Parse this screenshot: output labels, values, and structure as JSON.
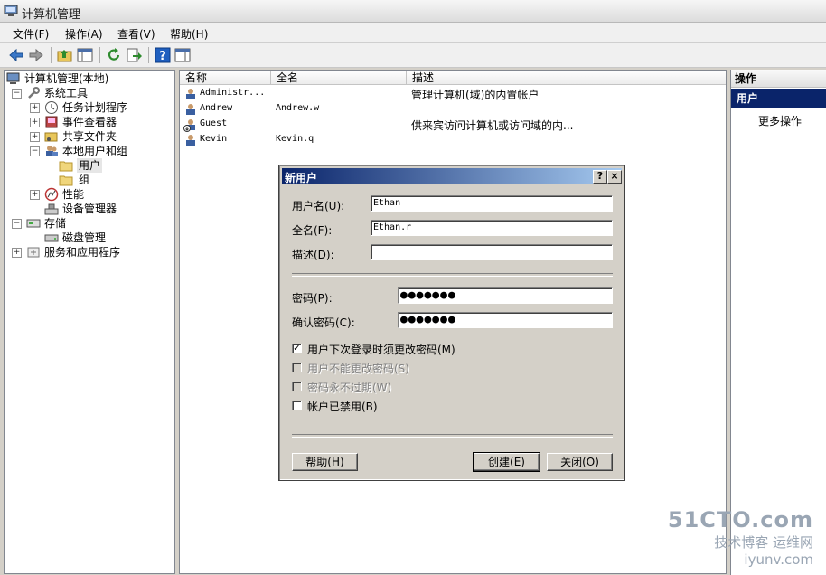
{
  "window": {
    "title": "计算机管理"
  },
  "menu": [
    "文件(F)",
    "操作(A)",
    "查看(V)",
    "帮助(H)"
  ],
  "toolbar_icons": [
    "back-arrow-icon",
    "forward-arrow-icon",
    "up-folder-icon",
    "show-hide-tree-icon",
    "refresh-icon",
    "export-list-icon",
    "help-icon",
    "properties-icon"
  ],
  "tree": {
    "root": "计算机管理(本地)",
    "system_tools": "系统工具",
    "task_scheduler": "任务计划程序",
    "event_viewer": "事件查看器",
    "shared_folders": "共享文件夹",
    "local_users_groups": "本地用户和组",
    "users": "用户",
    "groups": "组",
    "performance": "性能",
    "device_manager": "设备管理器",
    "storage": "存储",
    "disk_management": "磁盘管理",
    "services_apps": "服务和应用程序"
  },
  "list": {
    "columns": [
      "名称",
      "全名",
      "描述"
    ],
    "rows": [
      {
        "name": "Administr...",
        "fullname": "",
        "desc": "管理计算机(域)的内置帐户"
      },
      {
        "name": "Andrew",
        "fullname": "Andrew.w",
        "desc": ""
      },
      {
        "name": "Guest",
        "fullname": "",
        "desc": "供来宾访问计算机或访问域的内..."
      },
      {
        "name": "Kevin",
        "fullname": "Kevin.q",
        "desc": ""
      }
    ]
  },
  "actions": {
    "header": "操作",
    "section": "用户",
    "more": "更多操作"
  },
  "dialog": {
    "title": "新用户",
    "help_cap": "?",
    "close_cap": "×",
    "username_label": "用户名(U):",
    "username_value": "Ethan",
    "fullname_label": "全名(F):",
    "fullname_value": "Ethan.r",
    "description_label": "描述(D):",
    "description_value": "",
    "password_label": "密码(P):",
    "password_value": "●●●●●●●",
    "confirm_label": "确认密码(C):",
    "confirm_value": "●●●●●●●",
    "cb_must_change": "用户下次登录时须更改密码(M)",
    "cb_cannot_change": "用户不能更改密码(S)",
    "cb_never_expires": "密码永不过期(W)",
    "cb_disabled": "帐户已禁用(B)",
    "help_button": "帮助(H)",
    "create_button": "创建(E)",
    "close_button": "关闭(O)"
  },
  "watermark": {
    "line1": "51CTO.com",
    "line2": "技术博客",
    "line3": "运维网",
    "line4": "iyunv.com"
  }
}
